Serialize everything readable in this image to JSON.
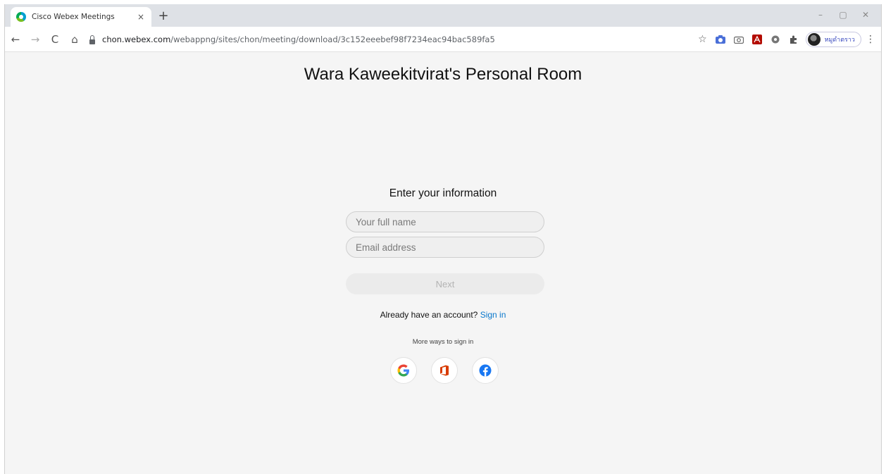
{
  "browser": {
    "tab_title": "Cisco Webex Meetings",
    "tab_close": "×",
    "new_tab": "+",
    "url_host": "chon.webex.com",
    "url_path": "/webappng/sites/chon/meeting/download/3c152eeebef98f7234eac94bac589fa5",
    "profile_name": "หมูดำตราว",
    "window_controls": {
      "minimize": "–",
      "maximize": "▢",
      "close": "✕"
    },
    "nav": {
      "back": "←",
      "forward": "→",
      "reload": "C",
      "home": "⌂"
    },
    "bookmark_star": "☆",
    "menu": "⋮",
    "extensions": [
      "camera-icon",
      "screenshot-icon",
      "pdf-icon",
      "settings-gear-icon",
      "puzzle-icon"
    ]
  },
  "page": {
    "title": "Wara Kaweekitvirat's Personal Room",
    "form_heading": "Enter your information",
    "name_placeholder": "Your full name",
    "email_placeholder": "Email address",
    "next_label": "Next",
    "account_prompt": "Already have an account?",
    "signin_label": "Sign in",
    "more_ways": "More ways to sign in",
    "social_providers": [
      "google-icon",
      "office-icon",
      "facebook-icon"
    ]
  },
  "colors": {
    "link": "#0a78cc",
    "google_blue": "#4285f4",
    "office_orange": "#d83b01",
    "facebook_blue": "#1877f2"
  }
}
